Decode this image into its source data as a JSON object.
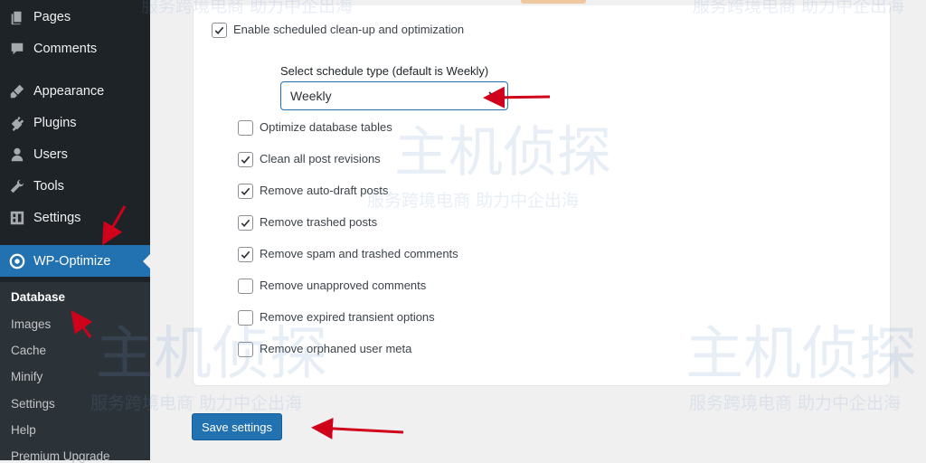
{
  "sidebar": {
    "items": [
      {
        "label": "Pages",
        "icon": "pages-icon"
      },
      {
        "label": "Comments",
        "icon": "comments-icon"
      },
      {
        "label": "Appearance",
        "icon": "appearance-icon"
      },
      {
        "label": "Plugins",
        "icon": "plugins-icon"
      },
      {
        "label": "Users",
        "icon": "users-icon"
      },
      {
        "label": "Tools",
        "icon": "tools-icon"
      },
      {
        "label": "Settings",
        "icon": "settings-icon"
      },
      {
        "label": "WP-Optimize",
        "icon": "wp-optimize-icon",
        "active": true
      }
    ],
    "submenu": [
      "Database",
      "Images",
      "Cache",
      "Minify",
      "Settings",
      "Help",
      "Premium Upgrade"
    ]
  },
  "main": {
    "enable_label": "Enable scheduled clean-up and optimization",
    "select_label": "Select schedule type (default is Weekly)",
    "select_value": "Weekly",
    "options": [
      {
        "label": "Optimize database tables",
        "checked": false
      },
      {
        "label": "Clean all post revisions",
        "checked": true
      },
      {
        "label": "Remove auto-draft posts",
        "checked": true
      },
      {
        "label": "Remove trashed posts",
        "checked": true
      },
      {
        "label": "Remove spam and trashed comments",
        "checked": true
      },
      {
        "label": "Remove unapproved comments",
        "checked": false
      },
      {
        "label": "Remove expired transient options",
        "checked": false
      },
      {
        "label": "Remove orphaned user meta",
        "checked": false
      }
    ],
    "save_label": "Save settings"
  },
  "watermark": {
    "brand": "主机侦探",
    "slogan": "服务跨境电商 助力中企出海"
  },
  "colors": {
    "sidebar_bg": "#1d2327",
    "accent": "#2271b1",
    "annotation": "#d0021b"
  }
}
